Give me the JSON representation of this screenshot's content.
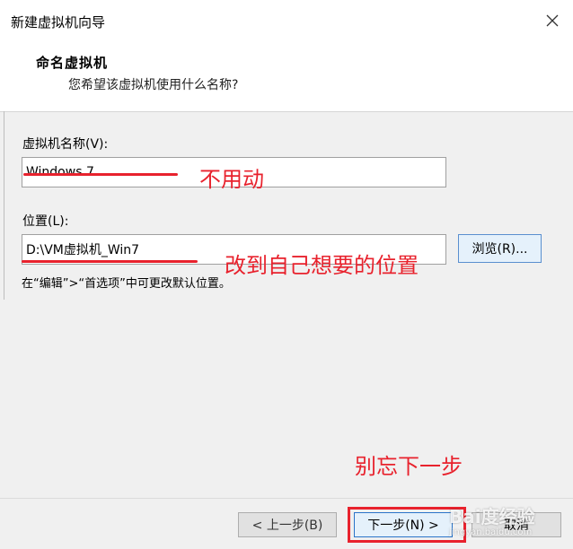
{
  "window": {
    "title": "新建虚拟机向导",
    "close_icon": "close-icon"
  },
  "header": {
    "title": "命名虚拟机",
    "subtitle": "您希望该虚拟机使用什么名称?"
  },
  "form": {
    "name_label": "虚拟机名称(V):",
    "name_value": "Windows 7",
    "location_label": "位置(L):",
    "location_value": "D:\\VM虚拟机_Win7",
    "browse_label": "浏览(R)...",
    "hint": "在“编辑”>“首选项”中可更改默认位置。"
  },
  "footer": {
    "back_label": "< 上一步(B)",
    "next_label": "下一步(N) >",
    "cancel_label": "取消"
  },
  "annotations": {
    "name_note": "不用动",
    "location_note": "改到自己想要的位置",
    "next_note": "别忘下一步",
    "color": "#e8222d"
  },
  "watermark": {
    "main": "Bai度经验",
    "sub": "jingyan.baidu.com"
  }
}
